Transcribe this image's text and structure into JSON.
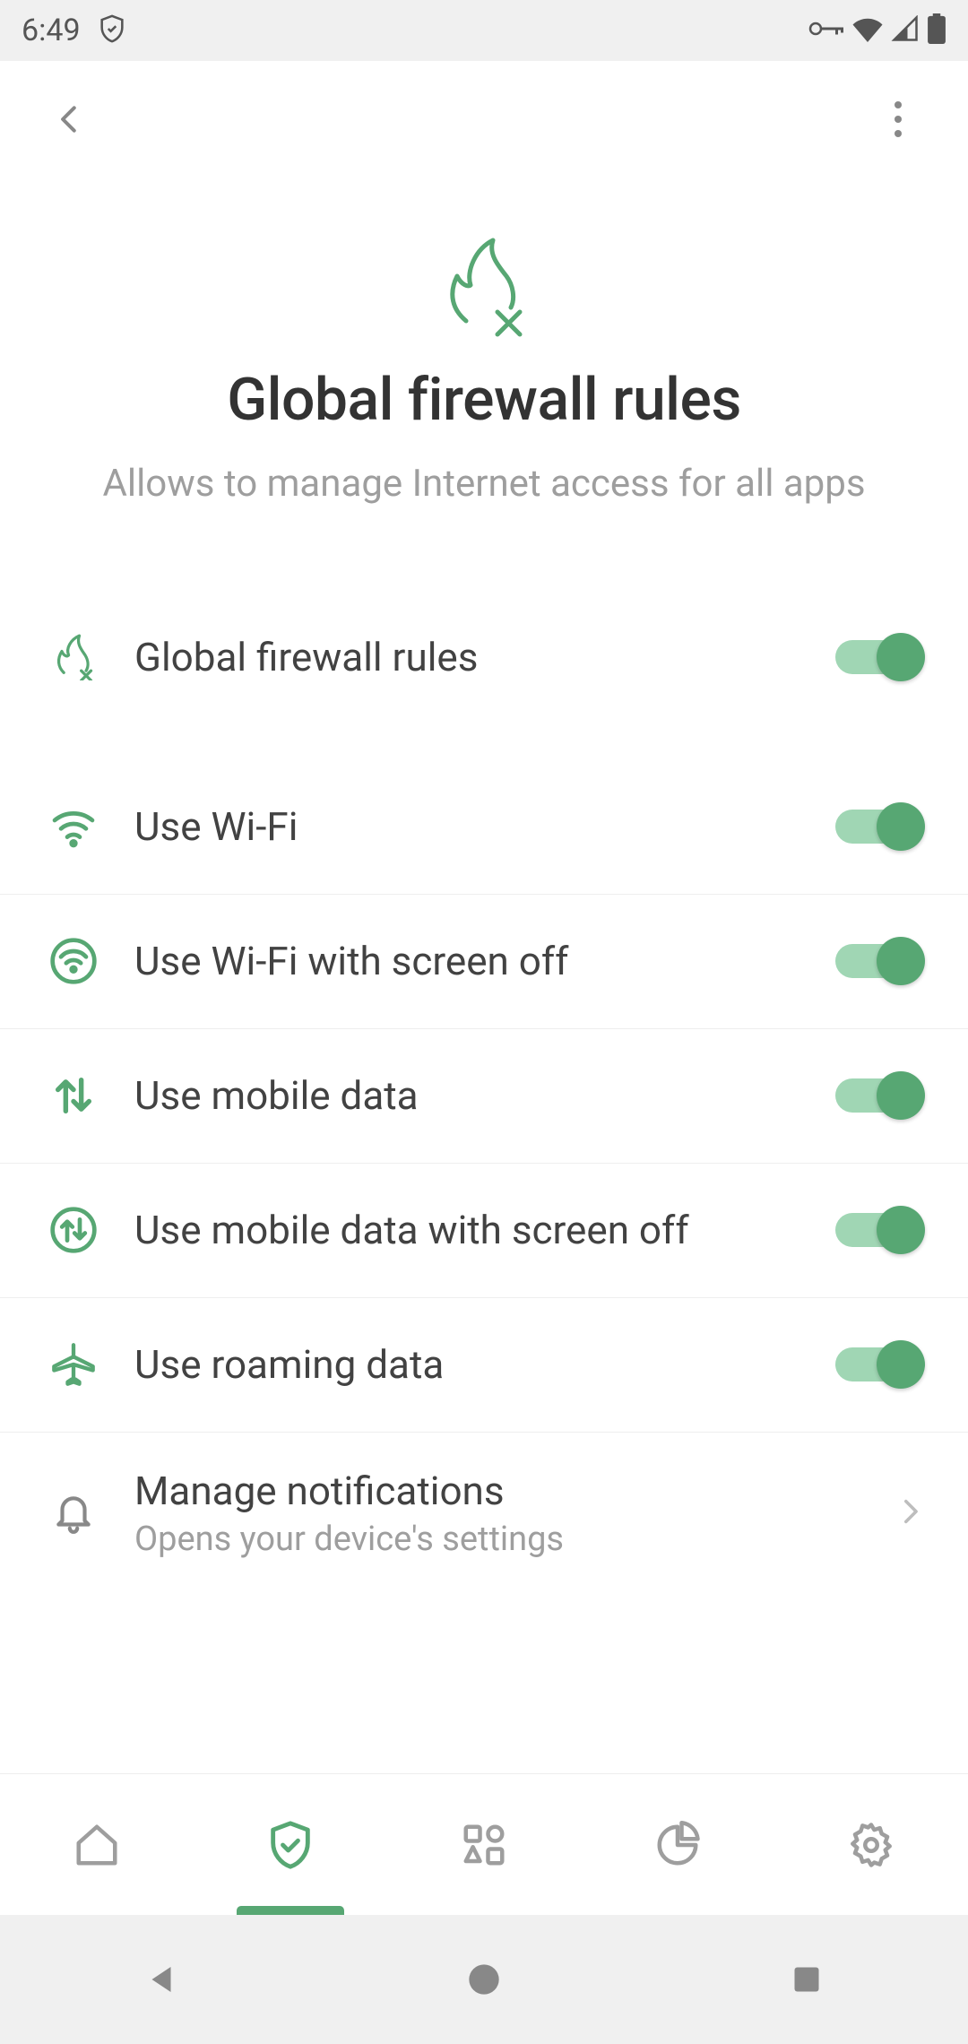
{
  "status": {
    "time": "6:49"
  },
  "page": {
    "title": "Global firewall rules",
    "subtitle": "Allows to manage Internet access for all apps"
  },
  "rows": {
    "master": {
      "label": "Global firewall rules",
      "on": true
    },
    "wifi": {
      "label": "Use Wi-Fi",
      "on": true
    },
    "wifiOff": {
      "label": "Use Wi-Fi with screen off",
      "on": true
    },
    "mobile": {
      "label": "Use mobile data",
      "on": true
    },
    "mobileOff": {
      "label": "Use mobile data with screen off",
      "on": true
    },
    "roaming": {
      "label": "Use roaming data",
      "on": true
    },
    "notif": {
      "label": "Manage notifications",
      "sub": "Opens your device's settings"
    }
  }
}
